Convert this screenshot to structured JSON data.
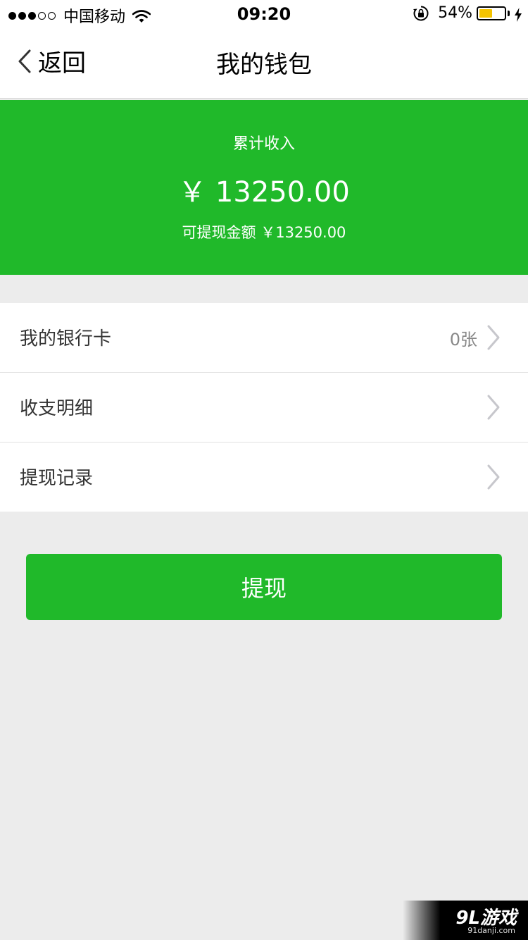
{
  "status_bar": {
    "signal_dots_filled": 3,
    "signal_dots_total": 5,
    "carrier": "中国移动",
    "time": "09:20",
    "battery_percent": "54%",
    "battery_level": 0.54,
    "battery_color": "#f5c400"
  },
  "nav": {
    "back_label": "返回",
    "title": "我的钱包"
  },
  "balance": {
    "total_label": "累计收入",
    "total_amount": "￥ 13250.00",
    "withdrawable": "可提现金额 ￥13250.00",
    "background_color": "#20b92a"
  },
  "menu": {
    "items": [
      {
        "label": "我的银行卡",
        "value": "0张"
      },
      {
        "label": "收支明细",
        "value": ""
      },
      {
        "label": "提现记录",
        "value": ""
      }
    ]
  },
  "actions": {
    "withdraw_label": "提现"
  },
  "watermark": {
    "logo": "9L游戏",
    "url": "91danji.com"
  },
  "icons": [
    "wifi-icon",
    "lock-icon",
    "bolt-icon",
    "chevron-left-icon",
    "chevron-right-icon"
  ]
}
